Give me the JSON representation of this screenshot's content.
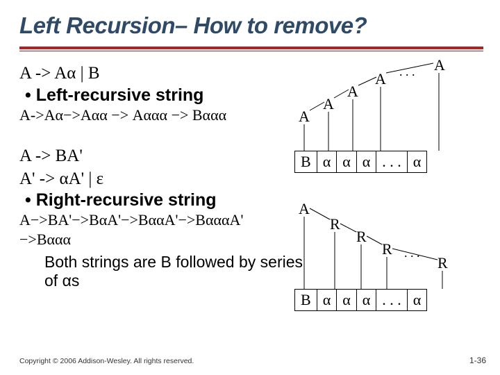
{
  "title": "Left Recursion– How to remove?",
  "left": {
    "rule1": "A -> Aα | B",
    "bullet1": "Left-recursive string",
    "deriv1": "A->Aα−>Aαα −> Aααα −> Bααα",
    "rule2a": "A -> BA'",
    "rule2b": "A' -> αA' | ε",
    "bullet2": "Right-recursive string",
    "deriv2a": "A−>BA'−>BαA'−>BααA'−>BαααA'",
    "deriv2b": "−>Bααα",
    "note": "Both strings are B followed by series of αs"
  },
  "tree1": {
    "A1": "A",
    "A2": "A",
    "A3": "A",
    "A4": "A",
    "A5": "A",
    "dots": ". . .",
    "row": {
      "c1": "B",
      "c2": "α",
      "c3": "α",
      "c4": "α",
      "c5": ". . .",
      "c6": "α"
    }
  },
  "tree2": {
    "A": "A",
    "R1": "R",
    "R2": "R",
    "R3": "R",
    "R4": "R",
    "dots": ". . .",
    "row": {
      "c1": "B",
      "c2": "α",
      "c3": "α",
      "c4": "α",
      "c5": ". . .",
      "c6": "α"
    }
  },
  "footer": "Copyright © 2006 Addison-Wesley. All rights reserved.",
  "pagenum": "1-36"
}
